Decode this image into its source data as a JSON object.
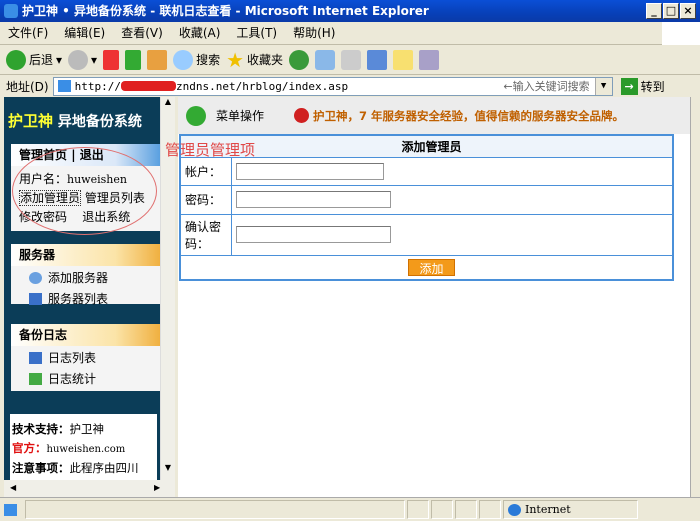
{
  "window": {
    "title": "护卫神 • 异地备份系统 - 联机日志查看 - Microsoft Internet Explorer",
    "min": "_",
    "max": "□",
    "close": "×"
  },
  "menu": [
    "文件(F)",
    "编辑(E)",
    "查看(V)",
    "收藏(A)",
    "工具(T)",
    "帮助(H)"
  ],
  "toolbar": {
    "back": "后退",
    "search": "搜索",
    "favorites": "收藏夹"
  },
  "address": {
    "label": "地址(D)",
    "url_prefix": "http://",
    "url_suffix": "zndns.net/hrblog/index.asp",
    "hint": "←输入关键词搜索",
    "go": "转到"
  },
  "sidebar": {
    "brand": "护卫神",
    "brand_sub": "异地备份系统",
    "admin": {
      "home": "管理首页",
      "sep": "|",
      "logout": "退出",
      "username_label": "用户名：",
      "username": "huweishen",
      "items": [
        "添加管理员",
        "管理员列表",
        "修改密码",
        "退出系统"
      ]
    },
    "server": {
      "title": "服务器",
      "items": [
        "添加服务器",
        "服务器列表"
      ]
    },
    "log": {
      "title": "备份日志",
      "items": [
        "日志列表",
        "日志统计"
      ]
    },
    "info": {
      "support_label": "技术支持：",
      "support": "护卫神",
      "official_label": "官方：",
      "official": "huweishen.com",
      "notice_label": "注意事项：",
      "notice": "此程序由四川"
    }
  },
  "main": {
    "menu_op": "菜单操作",
    "slogan": "护卫神，7 年服务器安全经验，值得信赖的服务器安全品牌。",
    "annotation": "管理员管理项",
    "form": {
      "title": "添加管理员",
      "account": "帐户：",
      "password": "密码：",
      "confirm": "确认密码：",
      "submit": "添加"
    }
  },
  "status": {
    "zone": "Internet"
  }
}
